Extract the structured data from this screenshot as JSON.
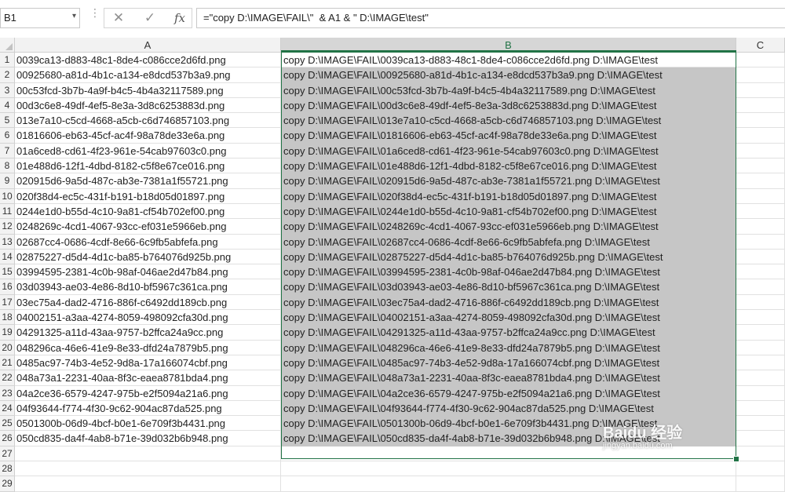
{
  "formula_bar": {
    "name_box": "B1",
    "cancel_icon": "✕",
    "enter_icon": "✓",
    "fx_label": "fx",
    "formula": "=\"copy D:\\IMAGE\\FAIL\\\"  & A1 & \" D:\\IMAGE\\test\""
  },
  "columns": [
    "A",
    "B",
    "C"
  ],
  "selected_column": "B",
  "rows": [
    {
      "n": "1",
      "a": "0039ca13-d883-48c1-8de4-c086cce2d6fd.png",
      "b": "copy D:\\IMAGE\\FAIL\\0039ca13-d883-48c1-8de4-c086cce2d6fd.png D:\\IMAGE\\test"
    },
    {
      "n": "2",
      "a": "00925680-a81d-4b1c-a134-e8dcd537b3a9.png",
      "b": "copy D:\\IMAGE\\FAIL\\00925680-a81d-4b1c-a134-e8dcd537b3a9.png D:\\IMAGE\\test"
    },
    {
      "n": "3",
      "a": "00c53fcd-3b7b-4a9f-b4c5-4b4a32117589.png",
      "b": "copy D:\\IMAGE\\FAIL\\00c53fcd-3b7b-4a9f-b4c5-4b4a32117589.png D:\\IMAGE\\test"
    },
    {
      "n": "4",
      "a": "00d3c6e8-49df-4ef5-8e3a-3d8c6253883d.png",
      "b": "copy D:\\IMAGE\\FAIL\\00d3c6e8-49df-4ef5-8e3a-3d8c6253883d.png D:\\IMAGE\\test"
    },
    {
      "n": "5",
      "a": "013e7a10-c5cd-4668-a5cb-c6d746857103.png",
      "b": "copy D:\\IMAGE\\FAIL\\013e7a10-c5cd-4668-a5cb-c6d746857103.png D:\\IMAGE\\test"
    },
    {
      "n": "6",
      "a": "01816606-eb63-45cf-ac4f-98a78de33e6a.png",
      "b": "copy D:\\IMAGE\\FAIL\\01816606-eb63-45cf-ac4f-98a78de33e6a.png D:\\IMAGE\\test"
    },
    {
      "n": "7",
      "a": "01a6ced8-cd61-4f23-961e-54cab97603c0.png",
      "b": "copy D:\\IMAGE\\FAIL\\01a6ced8-cd61-4f23-961e-54cab97603c0.png D:\\IMAGE\\test"
    },
    {
      "n": "8",
      "a": "01e488d6-12f1-4dbd-8182-c5f8e67ce016.png",
      "b": "copy D:\\IMAGE\\FAIL\\01e488d6-12f1-4dbd-8182-c5f8e67ce016.png D:\\IMAGE\\test"
    },
    {
      "n": "9",
      "a": "020915d6-9a5d-487c-ab3e-7381a1f55721.png",
      "b": "copy D:\\IMAGE\\FAIL\\020915d6-9a5d-487c-ab3e-7381a1f55721.png D:\\IMAGE\\test"
    },
    {
      "n": "10",
      "a": "020f38d4-ec5c-431f-b191-b18d05d01897.png",
      "b": "copy D:\\IMAGE\\FAIL\\020f38d4-ec5c-431f-b191-b18d05d01897.png D:\\IMAGE\\test"
    },
    {
      "n": "11",
      "a": "0244e1d0-b55d-4c10-9a81-cf54b702ef00.png",
      "b": "copy D:\\IMAGE\\FAIL\\0244e1d0-b55d-4c10-9a81-cf54b702ef00.png D:\\IMAGE\\test"
    },
    {
      "n": "12",
      "a": "0248269c-4cd1-4067-93cc-ef031e5966eb.png",
      "b": "copy D:\\IMAGE\\FAIL\\0248269c-4cd1-4067-93cc-ef031e5966eb.png D:\\IMAGE\\test"
    },
    {
      "n": "13",
      "a": "02687cc4-0686-4cdf-8e66-6c9fb5abfefa.png",
      "b": "copy D:\\IMAGE\\FAIL\\02687cc4-0686-4cdf-8e66-6c9fb5abfefa.png D:\\IMAGE\\test"
    },
    {
      "n": "14",
      "a": "02875227-d5d4-4d1c-ba85-b764076d925b.png",
      "b": "copy D:\\IMAGE\\FAIL\\02875227-d5d4-4d1c-ba85-b764076d925b.png D:\\IMAGE\\test"
    },
    {
      "n": "15",
      "a": "03994595-2381-4c0b-98af-046ae2d47b84.png",
      "b": "copy D:\\IMAGE\\FAIL\\03994595-2381-4c0b-98af-046ae2d47b84.png D:\\IMAGE\\test"
    },
    {
      "n": "16",
      "a": "03d03943-ae03-4e86-8d10-bf5967c361ca.png",
      "b": "copy D:\\IMAGE\\FAIL\\03d03943-ae03-4e86-8d10-bf5967c361ca.png D:\\IMAGE\\test"
    },
    {
      "n": "17",
      "a": "03ec75a4-dad2-4716-886f-c6492dd189cb.png",
      "b": "copy D:\\IMAGE\\FAIL\\03ec75a4-dad2-4716-886f-c6492dd189cb.png D:\\IMAGE\\test"
    },
    {
      "n": "18",
      "a": "04002151-a3aa-4274-8059-498092cfa30d.png",
      "b": "copy D:\\IMAGE\\FAIL\\04002151-a3aa-4274-8059-498092cfa30d.png D:\\IMAGE\\test"
    },
    {
      "n": "19",
      "a": "04291325-a11d-43aa-9757-b2ffca24a9cc.png",
      "b": "copy D:\\IMAGE\\FAIL\\04291325-a11d-43aa-9757-b2ffca24a9cc.png D:\\IMAGE\\test"
    },
    {
      "n": "20",
      "a": "048296ca-46e6-41e9-8e33-dfd24a7879b5.png",
      "b": "copy D:\\IMAGE\\FAIL\\048296ca-46e6-41e9-8e33-dfd24a7879b5.png D:\\IMAGE\\test"
    },
    {
      "n": "21",
      "a": "0485ac97-74b3-4e52-9d8a-17a166074cbf.png",
      "b": "copy D:\\IMAGE\\FAIL\\0485ac97-74b3-4e52-9d8a-17a166074cbf.png D:\\IMAGE\\test"
    },
    {
      "n": "22",
      "a": "048a73a1-2231-40aa-8f3c-eaea8781bda4.png",
      "b": "copy D:\\IMAGE\\FAIL\\048a73a1-2231-40aa-8f3c-eaea8781bda4.png D:\\IMAGE\\test"
    },
    {
      "n": "23",
      "a": "04a2ce36-6579-4247-975b-e2f5094a21a6.png",
      "b": "copy D:\\IMAGE\\FAIL\\04a2ce36-6579-4247-975b-e2f5094a21a6.png D:\\IMAGE\\test"
    },
    {
      "n": "24",
      "a": "04f93644-f774-4f30-9c62-904ac87da525.png",
      "b": "copy D:\\IMAGE\\FAIL\\04f93644-f774-4f30-9c62-904ac87da525.png D:\\IMAGE\\test"
    },
    {
      "n": "25",
      "a": "0501300b-06d9-4bcf-b0e1-6e709f3b4431.png",
      "b": "copy D:\\IMAGE\\FAIL\\0501300b-06d9-4bcf-b0e1-6e709f3b4431.png D:\\IMAGE\\test"
    },
    {
      "n": "26",
      "a": "050cd835-da4f-4ab8-b71e-39d032b6b948.png",
      "b": "copy D:\\IMAGE\\FAIL\\050cd835-da4f-4ab8-b71e-39d032b6b948.png D:\\IMAGE\\test"
    },
    {
      "n": "27",
      "a": "",
      "b": ""
    },
    {
      "n": "28",
      "a": "",
      "b": ""
    },
    {
      "n": "29",
      "a": "",
      "b": ""
    }
  ],
  "watermark": {
    "text": "Baidu 经验",
    "sub": "jingyan.baidu.com"
  },
  "colors": {
    "accent": "#217346",
    "selection_fill": "#c6c6c6"
  }
}
